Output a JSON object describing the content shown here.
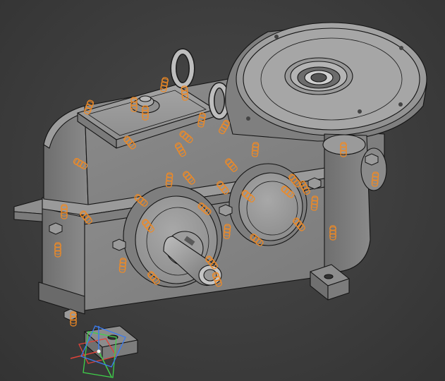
{
  "viewport": {
    "background": "#3c3c3c",
    "body_color": "#8a8a8a",
    "edge_color": "#141414",
    "highlight_color": "#f08a24"
  },
  "triad": {
    "x_color": "#e0433a",
    "y_color": "#3fd04a",
    "z_color": "#3b7cf0"
  },
  "model": {
    "type": "gearbox-assembly",
    "highlighted_fasteners": 38
  }
}
